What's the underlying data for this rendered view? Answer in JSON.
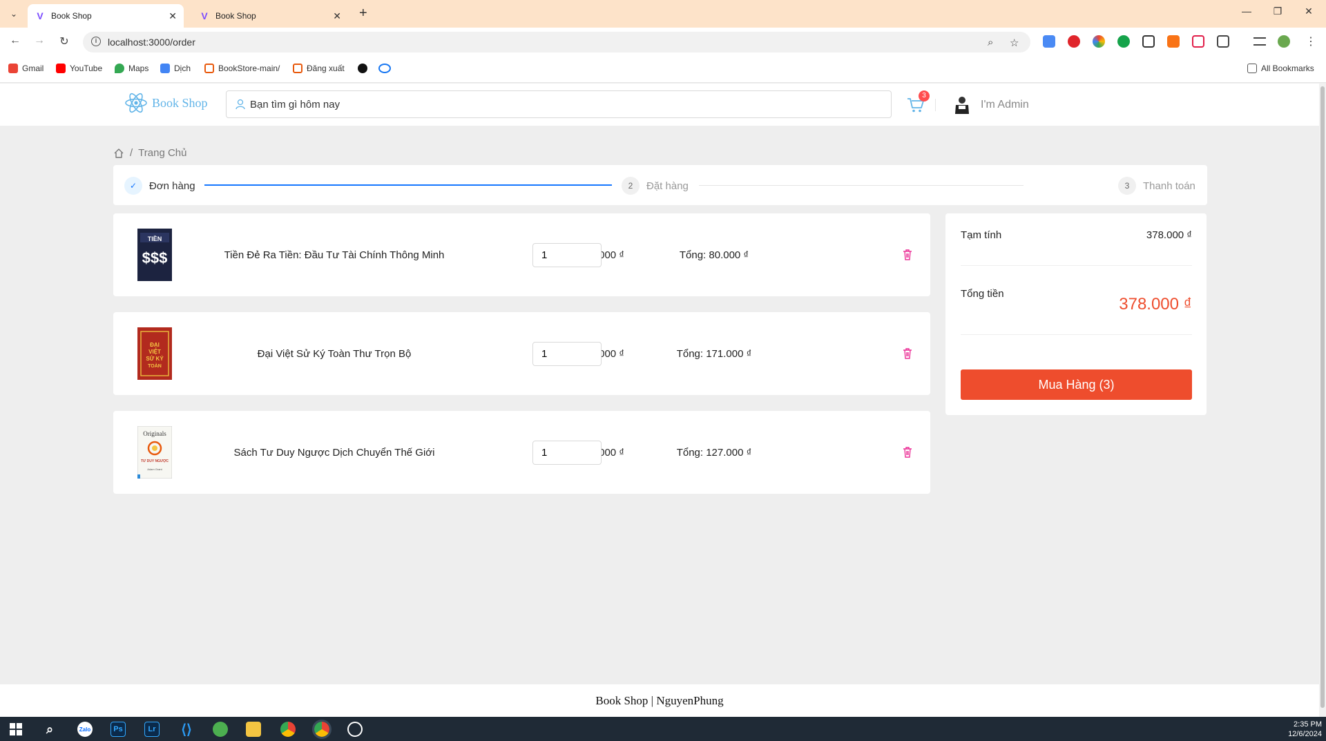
{
  "browser": {
    "tabs": [
      {
        "title": "Book Shop",
        "active": true
      },
      {
        "title": "Book Shop",
        "active": false
      }
    ],
    "url": "localhost:3000/order",
    "bookmarks": [
      "Gmail",
      "YouTube",
      "Maps",
      "Dịch",
      "BookStore-main/",
      "Đăng xuất"
    ],
    "all_bookmarks": "All Bookmarks"
  },
  "header": {
    "logo_text": "Book Shop",
    "search_placeholder": "Bạn tìm gì hôm nay",
    "cart_count": "3",
    "admin_name": "I'm Admin"
  },
  "breadcrumb": {
    "home": "Trang Chủ"
  },
  "steps": [
    {
      "number": "",
      "label": "Đơn hàng",
      "status": "done"
    },
    {
      "number": "2",
      "label": "Đặt hàng",
      "status": "wait"
    },
    {
      "number": "3",
      "label": "Thanh toán",
      "status": "wait"
    }
  ],
  "cart": {
    "items": [
      {
        "name": "Tiền Đẻ Ra Tiền: Đầu Tư Tài Chính Thông Minh",
        "price": "80.000 ₫",
        "quantity": "1",
        "total": "Tổng: 80.000 ₫"
      },
      {
        "name": "Đại Việt Sử Ký Toàn Thư Trọn Bộ",
        "price": "171.000 ₫",
        "quantity": "1",
        "total": "Tổng: 171.000 ₫"
      },
      {
        "name": "Sách Tư Duy Ngược Dịch Chuyển Thế Giới",
        "price": "127.000 ₫",
        "quantity": "1",
        "total": "Tổng: 127.000 ₫"
      }
    ]
  },
  "summary": {
    "subtotal_label": "Tạm tính",
    "subtotal_value": "378.000 ₫",
    "total_label": "Tổng tiền",
    "total_value": "378.000 ₫",
    "buy_button": "Mua Hàng (3)"
  },
  "footer": {
    "text": "Book Shop | NguyenPhung"
  },
  "taskbar": {
    "time": "2:35 PM",
    "date": "12/6/2024"
  },
  "colors": {
    "accent": "#ee4d2d",
    "step_active": "#1677ff",
    "logo": "#61b4e8",
    "delete_icon": "#eb2f96"
  }
}
